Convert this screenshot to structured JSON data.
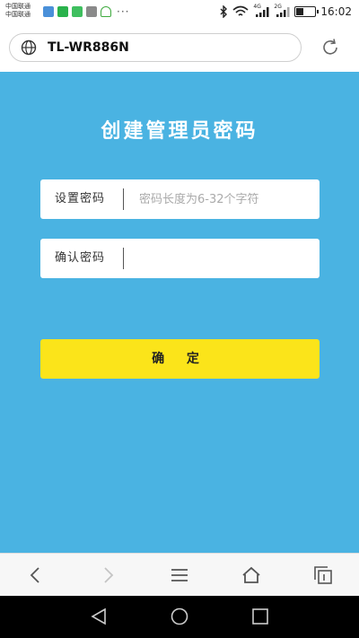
{
  "status_bar": {
    "carrier_line1": "中国联通",
    "carrier_line2": "中国联通",
    "more_label": "···",
    "signal1_label": "4G",
    "signal2_label": "2G",
    "time": "16:02",
    "icons": [
      "bluetooth-icon",
      "wifi-icon",
      "signal-4g-icon",
      "signal-2g-icon",
      "battery-icon"
    ]
  },
  "browser": {
    "url": "TL-WR886N"
  },
  "page": {
    "title": "创建管理员密码",
    "set_password": {
      "label": "设置密码",
      "value": "",
      "placeholder": "密码长度为6-32个字符"
    },
    "confirm_password": {
      "label": "确认密码",
      "value": "",
      "placeholder": ""
    },
    "confirm_button_label": "确 定"
  },
  "colors": {
    "page_background": "#4ab3e2",
    "button_background": "#fbe41a",
    "field_background": "#ffffff"
  }
}
